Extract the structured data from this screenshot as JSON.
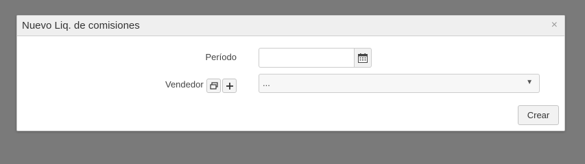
{
  "dialog": {
    "title": "Nuevo Liq. de comisiones",
    "close_glyph": "×"
  },
  "form": {
    "periodo": {
      "label": "Período",
      "value": "",
      "icon": "calendar-icon"
    },
    "vendedor": {
      "label": "Vendedor",
      "selected": "...",
      "arrow_glyph": "▼",
      "buttons": [
        {
          "icon": "windows-icon"
        },
        {
          "icon": "plus-icon"
        }
      ]
    }
  },
  "actions": {
    "crear_label": "Crear"
  },
  "colors": {
    "backdrop": "#7a7a7a",
    "titlebar": "#efefef",
    "button_bg": "#f2f2f2"
  }
}
